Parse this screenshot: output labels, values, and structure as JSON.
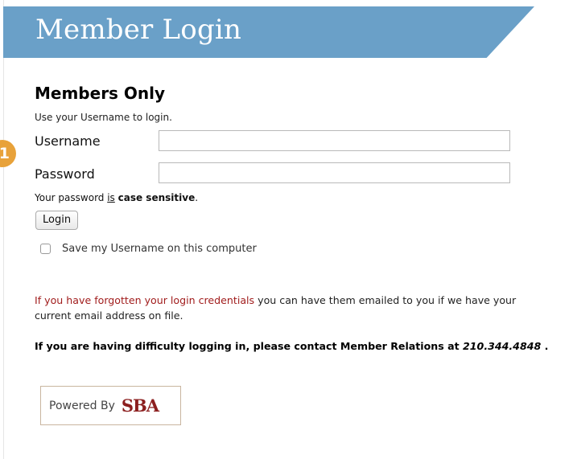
{
  "banner": {
    "title": "Member Login"
  },
  "step_badge": "1",
  "form": {
    "heading": "Members Only",
    "hint": "Use your Username to login.",
    "username_label": "Username",
    "username_value": "",
    "password_label": "Password",
    "password_value": "",
    "password_note_prefix": "Your password ",
    "password_note_is": "is",
    "password_note_bold": "case sensitive",
    "password_note_suffix": ".",
    "login_button": "Login",
    "save_username_label": "Save my Username on this computer"
  },
  "help": {
    "forgot_link": "If you have forgotten your login credentials",
    "forgot_text": " you can have them emailed to you if we have your current email address on file.",
    "difficulty_text": "If you are having difficulty logging in, please contact Member Relations at ",
    "phone": "210.344.4848",
    "phone_suffix": " ."
  },
  "footer": {
    "powered_by": "Powered By",
    "logo_text": "SBA"
  },
  "colors": {
    "banner": "#6aa0c8",
    "badge": "#e8a23a",
    "link": "#a11d1d",
    "logo": "#8c1f1f"
  }
}
